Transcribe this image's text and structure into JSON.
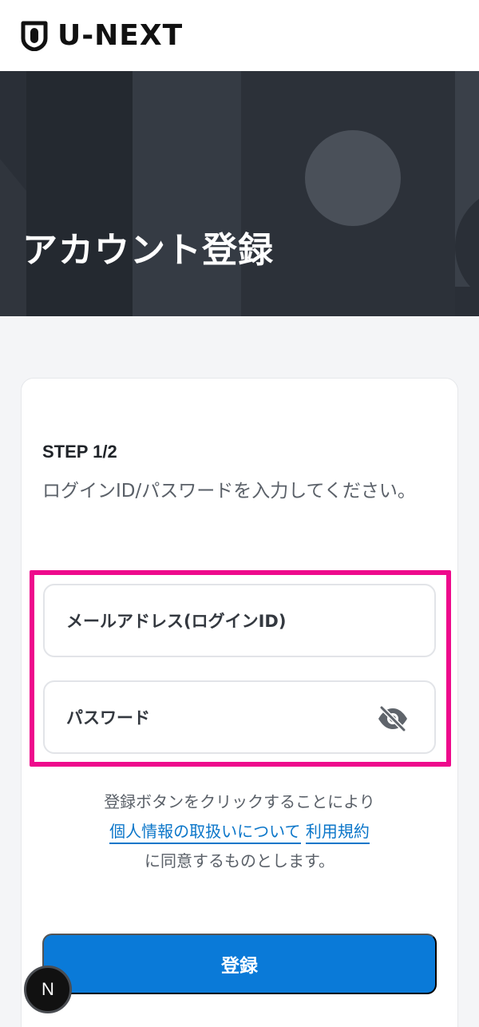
{
  "header": {
    "brand": "U-NEXT"
  },
  "hero": {
    "title": "アカウント登録"
  },
  "form": {
    "step": "STEP 1/2",
    "instruction": "ログインID/パスワードを入力してください。",
    "email_label": "メールアドレス(ログインID)",
    "password_label": "パスワード"
  },
  "agreement": {
    "line1": "登録ボタンをクリックすることにより",
    "privacy_link": "個人情報の取扱いについて",
    "terms_link": "利用規約",
    "line3": "に同意するものとします。"
  },
  "submit_label": "登録",
  "floating_badge": "N",
  "colors": {
    "accent": "#0a7ad8",
    "highlight": "#ee0a8c",
    "link": "#0b76c9",
    "hero_bg": "#2b3038"
  },
  "icons": {
    "logo": "shield-icon",
    "password_visibility": "eye-off-icon"
  }
}
